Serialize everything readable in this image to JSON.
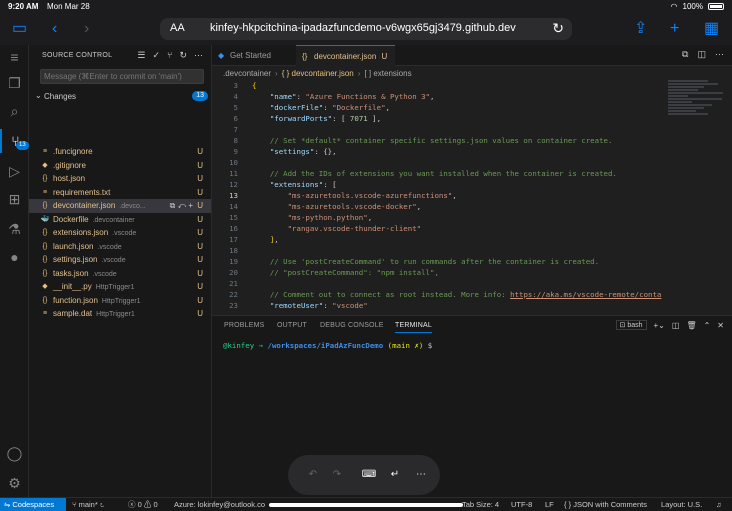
{
  "ipad": {
    "time": "9:20 AM",
    "date": "Mon Mar 28",
    "battery": "100%"
  },
  "safari": {
    "aa": "AA",
    "url": "kinfey-hkpcitchina-ipadazfuncdemo-v6wgx65gj3479.github.dev"
  },
  "sidebar": {
    "title": "SOURCE CONTROL",
    "commit_placeholder": "Message (⌘Enter to commit on 'main')",
    "changes_label": "Changes",
    "changes_count": "13",
    "files": [
      {
        "icon": "≡",
        "name": ".funcignore",
        "dir": "",
        "status": "U"
      },
      {
        "icon": "◆",
        "name": ".gitignore",
        "dir": "",
        "status": "U"
      },
      {
        "icon": "{}",
        "name": "host.json",
        "dir": "",
        "status": "U"
      },
      {
        "icon": "≡",
        "name": "requirements.txt",
        "dir": "",
        "status": "U"
      },
      {
        "icon": "{}",
        "name": "devcontainer.json",
        "dir": ".devco...",
        "status": "U"
      },
      {
        "icon": "🐳",
        "name": "Dockerfile",
        "dir": ".devcontainer",
        "status": "U"
      },
      {
        "icon": "{}",
        "name": "extensions.json",
        "dir": ".vscode",
        "status": "U"
      },
      {
        "icon": "{}",
        "name": "launch.json",
        "dir": ".vscode",
        "status": "U"
      },
      {
        "icon": "{}",
        "name": "settings.json",
        "dir": ".vscode",
        "status": "U"
      },
      {
        "icon": "{}",
        "name": "tasks.json",
        "dir": ".vscode",
        "status": "U"
      },
      {
        "icon": "◆",
        "name": "__init__.py",
        "dir": "HttpTrigger1",
        "status": "U"
      },
      {
        "icon": "{}",
        "name": "function.json",
        "dir": "HttpTrigger1",
        "status": "U"
      },
      {
        "icon": "≡",
        "name": "sample.dat",
        "dir": "HttpTrigger1",
        "status": "U"
      }
    ]
  },
  "editor": {
    "tabs": [
      {
        "label": "Get Started"
      },
      {
        "label": "devcontainer.json",
        "status": "U"
      }
    ],
    "breadcrumb": [
      ".devcontainer",
      "{ } devcontainer.json",
      "[ ] extensions"
    ],
    "lines": [
      {
        "n": "3",
        "t": "{"
      },
      {
        "n": "4",
        "t": "    \"name\": \"Azure Functions & Python 3\","
      },
      {
        "n": "5",
        "t": "    \"dockerFile\": \"Dockerfile\","
      },
      {
        "n": "6",
        "t": "    \"forwardPorts\": [ 7071 ],"
      },
      {
        "n": "7",
        "t": ""
      },
      {
        "n": "8",
        "t": "    // Set *default* container specific settings.json values on container create."
      },
      {
        "n": "9",
        "t": "    \"settings\": {},"
      },
      {
        "n": "10",
        "t": ""
      },
      {
        "n": "11",
        "t": "    // Add the IDs of extensions you want installed when the container is created."
      },
      {
        "n": "12",
        "t": "    \"extensions\": ["
      },
      {
        "n": "13",
        "t": "        \"ms-azuretools.vscode-azurefunctions\","
      },
      {
        "n": "14",
        "t": "        \"ms-azuretools.vscode-docker\","
      },
      {
        "n": "15",
        "t": "        \"ms-python.python\","
      },
      {
        "n": "16",
        "t": "        \"rangav.vscode-thunder-client\""
      },
      {
        "n": "17",
        "t": "    ],"
      },
      {
        "n": "18",
        "t": ""
      },
      {
        "n": "19",
        "t": "    // Use 'postCreateCommand' to run commands after the container is created."
      },
      {
        "n": "20",
        "t": "    // \"postCreateCommand\": \"npm install\","
      },
      {
        "n": "21",
        "t": ""
      },
      {
        "n": "22",
        "t": "    // Comment out to connect as root instead. More info: https://aka.ms/vscode-remote/conta"
      },
      {
        "n": "23",
        "t": "    \"remoteUser\": \"vscode\""
      }
    ]
  },
  "panel": {
    "tabs": [
      "PROBLEMS",
      "OUTPUT",
      "DEBUG CONSOLE",
      "TERMINAL"
    ],
    "shell": "bash",
    "prompt_user": "@kinfey",
    "prompt_arrow": "→",
    "prompt_path": "/workspaces/iPadAzFuncDemo",
    "prompt_branch": "(main ✗)",
    "prompt_symbol": "$"
  },
  "statusbar": {
    "remote": "Codespaces",
    "branch": "main*",
    "errors": "0",
    "warnings": "0",
    "account": "Azure: lokinfey@outlook.co",
    "tab_size": "Tab Size: 4",
    "encoding": "UTF-8",
    "eol": "LF",
    "language": "JSON with Comments",
    "layout": "Layout: U.S."
  }
}
